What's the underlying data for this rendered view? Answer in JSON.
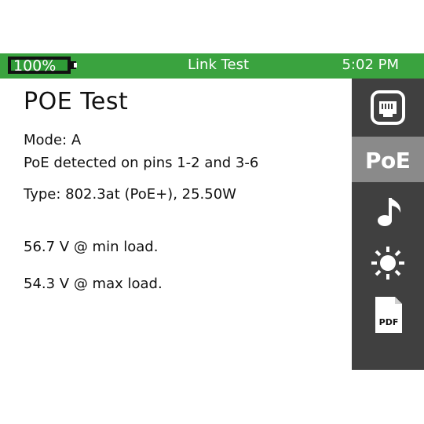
{
  "status": {
    "battery": "100%",
    "battery_level": 1.0,
    "title": "Link Test",
    "time": "5:02 PM"
  },
  "main": {
    "title": "POE Test",
    "mode": "Mode: A",
    "detected": "PoE detected on pins 1-2 and 3-6",
    "type": "Type: 802.3at (PoE+), 25.50W",
    "min_load": "56.7 V @ min load.",
    "max_load": "54.3 V @ max load."
  },
  "sidebar": {
    "items": [
      {
        "icon": "ethernet-port-icon",
        "selected": false
      },
      {
        "label": "PoE",
        "selected": true
      },
      {
        "icon": "music-note-icon",
        "selected": false
      },
      {
        "icon": "brightness-sun-icon",
        "selected": false
      },
      {
        "icon": "pdf-file-icon",
        "label": "PDF",
        "selected": false
      }
    ]
  },
  "colors": {
    "status_bar": "#3aa33f",
    "sidebar_bg": "#404040",
    "sidebar_active": "#8a8a8a",
    "text": "#111111"
  }
}
